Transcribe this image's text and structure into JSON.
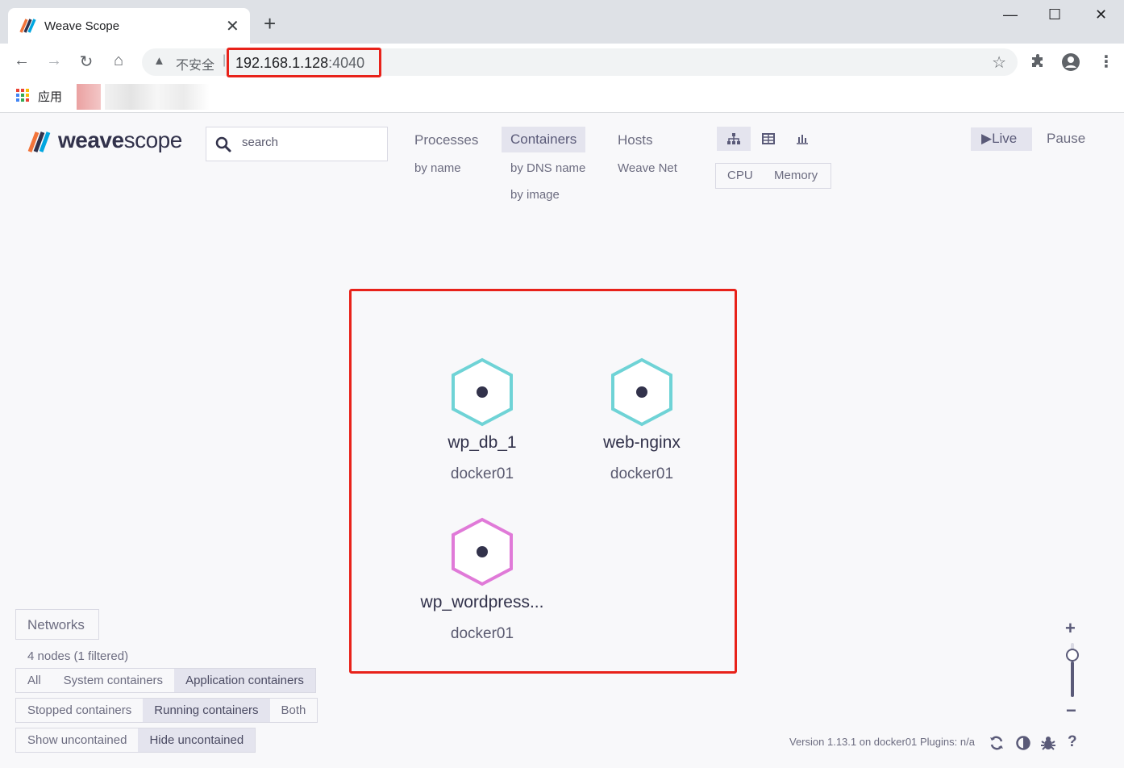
{
  "browser": {
    "tab_title": "Weave Scope",
    "tab_close": "✕",
    "new_tab": "+",
    "insecure_label": "不安全",
    "separator": "|",
    "url_host": "192.168.1.128",
    "url_port": ":4040",
    "apps_label": "应用",
    "window_controls": [
      "—",
      "☐",
      "✕"
    ]
  },
  "app": {
    "logo_bold": "weave",
    "logo_light": "scope",
    "search_placeholder": "search",
    "topologies": [
      {
        "label": "Processes",
        "sub": [
          "by name"
        ]
      },
      {
        "label": "Containers",
        "sub": [
          "by DNS name",
          "by image"
        ]
      },
      {
        "label": "Hosts",
        "sub": [
          "Weave Net"
        ]
      }
    ],
    "metrics": [
      "CPU",
      "Memory"
    ],
    "live": "Live",
    "pause": "Pause"
  },
  "graph": {
    "nodes": [
      {
        "label": "wp_db_1",
        "sub": "docker01",
        "color": "#6fd3d6"
      },
      {
        "label": "web-nginx",
        "sub": "docker01",
        "color": "#6fd3d6"
      },
      {
        "label": "wp_wordpress...",
        "sub": "docker01",
        "color": "#e07ad8"
      }
    ]
  },
  "footer": {
    "networks": "Networks",
    "node_count": "4 nodes (1 filtered)",
    "filters_row1": [
      "All",
      "System containers",
      "Application containers"
    ],
    "filters_row2": [
      "Stopped containers",
      "Running containers",
      "Both"
    ],
    "filters_row3": [
      "Show uncontained",
      "Hide uncontained"
    ],
    "version": "Version 1.13.1 on docker01",
    "plugins": "Plugins: n/a",
    "zoom_plus": "+",
    "zoom_minus": "−"
  },
  "colors": {
    "accent": "#5a5a78",
    "highlight_box": "#e8221a",
    "node_cyan": "#6fd3d6",
    "node_pink": "#e07ad8"
  },
  "icons": [
    "back-icon",
    "forward-icon",
    "reload-icon",
    "home-icon",
    "warning-icon",
    "star-icon",
    "extensions-icon",
    "profile-icon",
    "menu-icon",
    "search-icon",
    "graph-view-icon",
    "table-view-icon",
    "resource-view-icon",
    "play-icon",
    "refresh-icon",
    "contrast-icon",
    "bug-icon",
    "help-icon"
  ]
}
